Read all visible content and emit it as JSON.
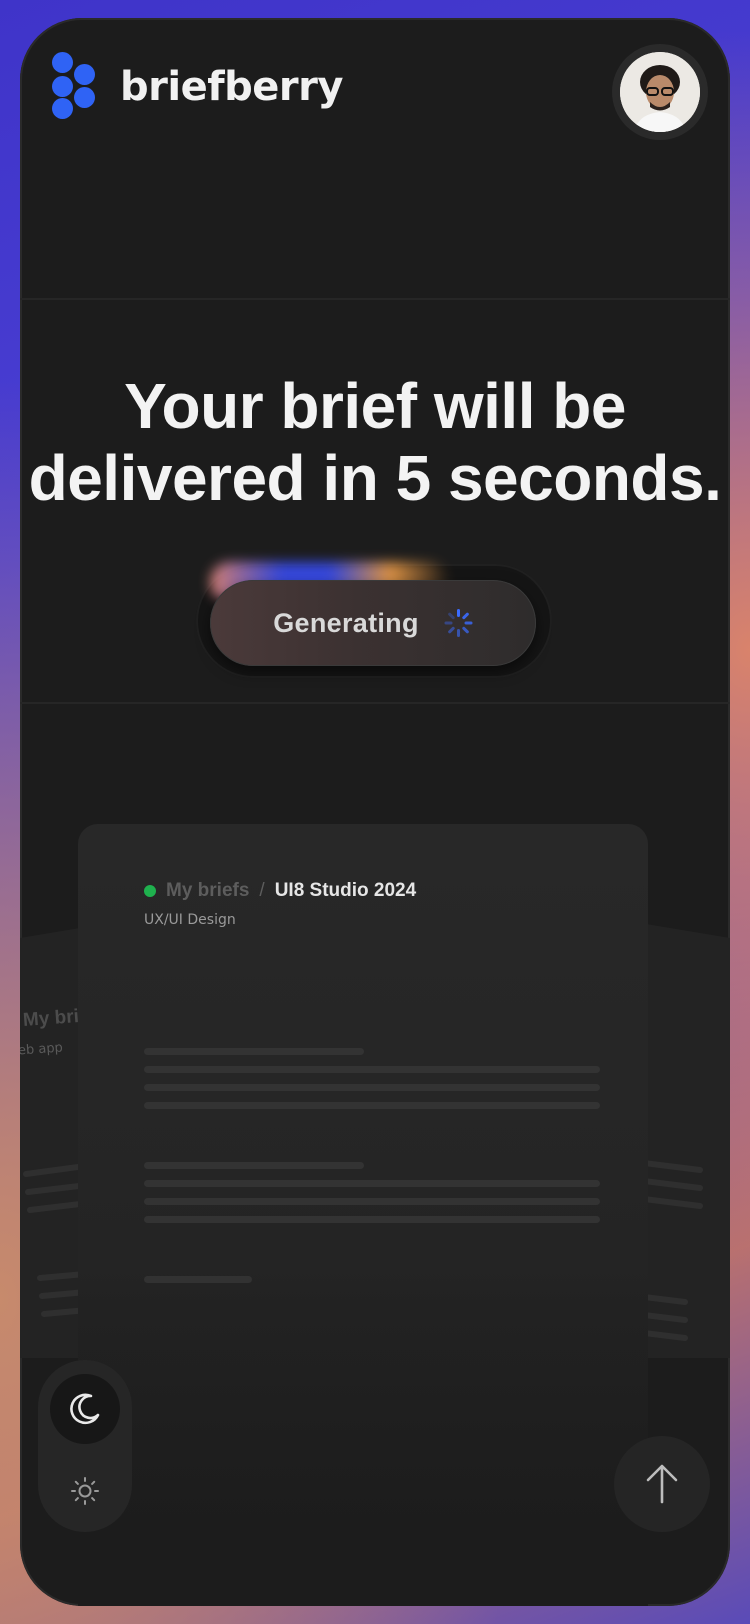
{
  "brand": {
    "name": "briefberry",
    "accent": "#2f63f5"
  },
  "header": {
    "avatar_label": "User avatar"
  },
  "hero": {
    "headline_line1": "Your brief will be",
    "headline_line2": "delivered in 5 seconds."
  },
  "generate": {
    "label": "Generating",
    "spinner_color": "#3b6cff"
  },
  "preview": {
    "status_color": "#1fb14e",
    "breadcrumb_parent": "My briefs",
    "breadcrumb_sep": "/",
    "breadcrumb_current": "UI8 Studio 2024",
    "subtitle": "UX/UI Design",
    "peek_title": "My bri",
    "peek_subtitle": "eb app"
  },
  "theme": {
    "moon_icon": "moon-icon",
    "sun_icon": "sun-icon"
  },
  "scroll": {
    "icon": "arrow-up-icon"
  }
}
